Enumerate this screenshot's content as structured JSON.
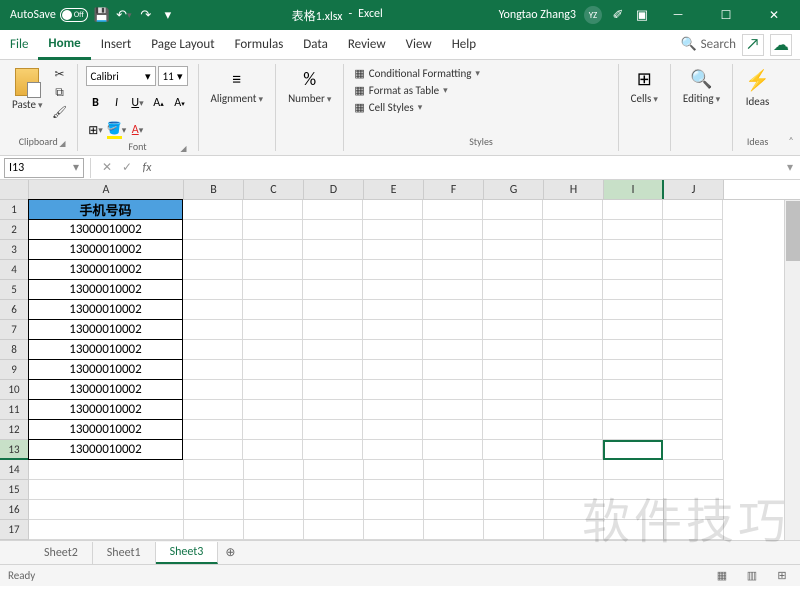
{
  "titlebar": {
    "autosave": "AutoSave",
    "toggle": "Off",
    "filename": "表格1.xlsx",
    "app": "Excel",
    "user": "Yongtao Zhang3",
    "initials": "YZ"
  },
  "menu": {
    "file": "File",
    "home": "Home",
    "insert": "Insert",
    "pagelayout": "Page Layout",
    "formulas": "Formulas",
    "data": "Data",
    "review": "Review",
    "view": "View",
    "help": "Help",
    "search": "Search"
  },
  "ribbon": {
    "clipboard": {
      "label": "Clipboard",
      "paste": "Paste"
    },
    "font": {
      "label": "Font",
      "name": "Calibri",
      "size": "11"
    },
    "alignment": {
      "label": "Alignment"
    },
    "number": {
      "label": "Number"
    },
    "styles": {
      "label": "Styles",
      "condfmt": "Conditional Formatting",
      "fmttable": "Format as Table",
      "cellstyles": "Cell Styles"
    },
    "cells": {
      "label": "Cells"
    },
    "editing": {
      "label": "Editing"
    },
    "ideas": {
      "label": "Ideas",
      "btn": "Ideas"
    }
  },
  "formulabar": {
    "namebox": "I13",
    "fx": "fx"
  },
  "columns": [
    "A",
    "B",
    "C",
    "D",
    "E",
    "F",
    "G",
    "H",
    "I",
    "J"
  ],
  "rows": [
    {
      "n": "1",
      "v": "手机号码",
      "hdr": true
    },
    {
      "n": "2",
      "v": "13000010002"
    },
    {
      "n": "3",
      "v": "13000010002"
    },
    {
      "n": "4",
      "v": "13000010002"
    },
    {
      "n": "5",
      "v": "13000010002"
    },
    {
      "n": "6",
      "v": "13000010002"
    },
    {
      "n": "7",
      "v": "13000010002"
    },
    {
      "n": "8",
      "v": "13000010002"
    },
    {
      "n": "9",
      "v": "13000010002"
    },
    {
      "n": "10",
      "v": "13000010002"
    },
    {
      "n": "11",
      "v": "13000010002"
    },
    {
      "n": "12",
      "v": "13000010002"
    },
    {
      "n": "13",
      "v": "13000010002"
    },
    {
      "n": "14",
      "v": ""
    },
    {
      "n": "15",
      "v": ""
    },
    {
      "n": "16",
      "v": ""
    },
    {
      "n": "17",
      "v": ""
    }
  ],
  "selected": {
    "row": "13",
    "col": "I"
  },
  "tabs": [
    "Sheet2",
    "Sheet1",
    "Sheet3"
  ],
  "activeTab": "Sheet3",
  "status": "Ready",
  "watermark": "软件技巧"
}
